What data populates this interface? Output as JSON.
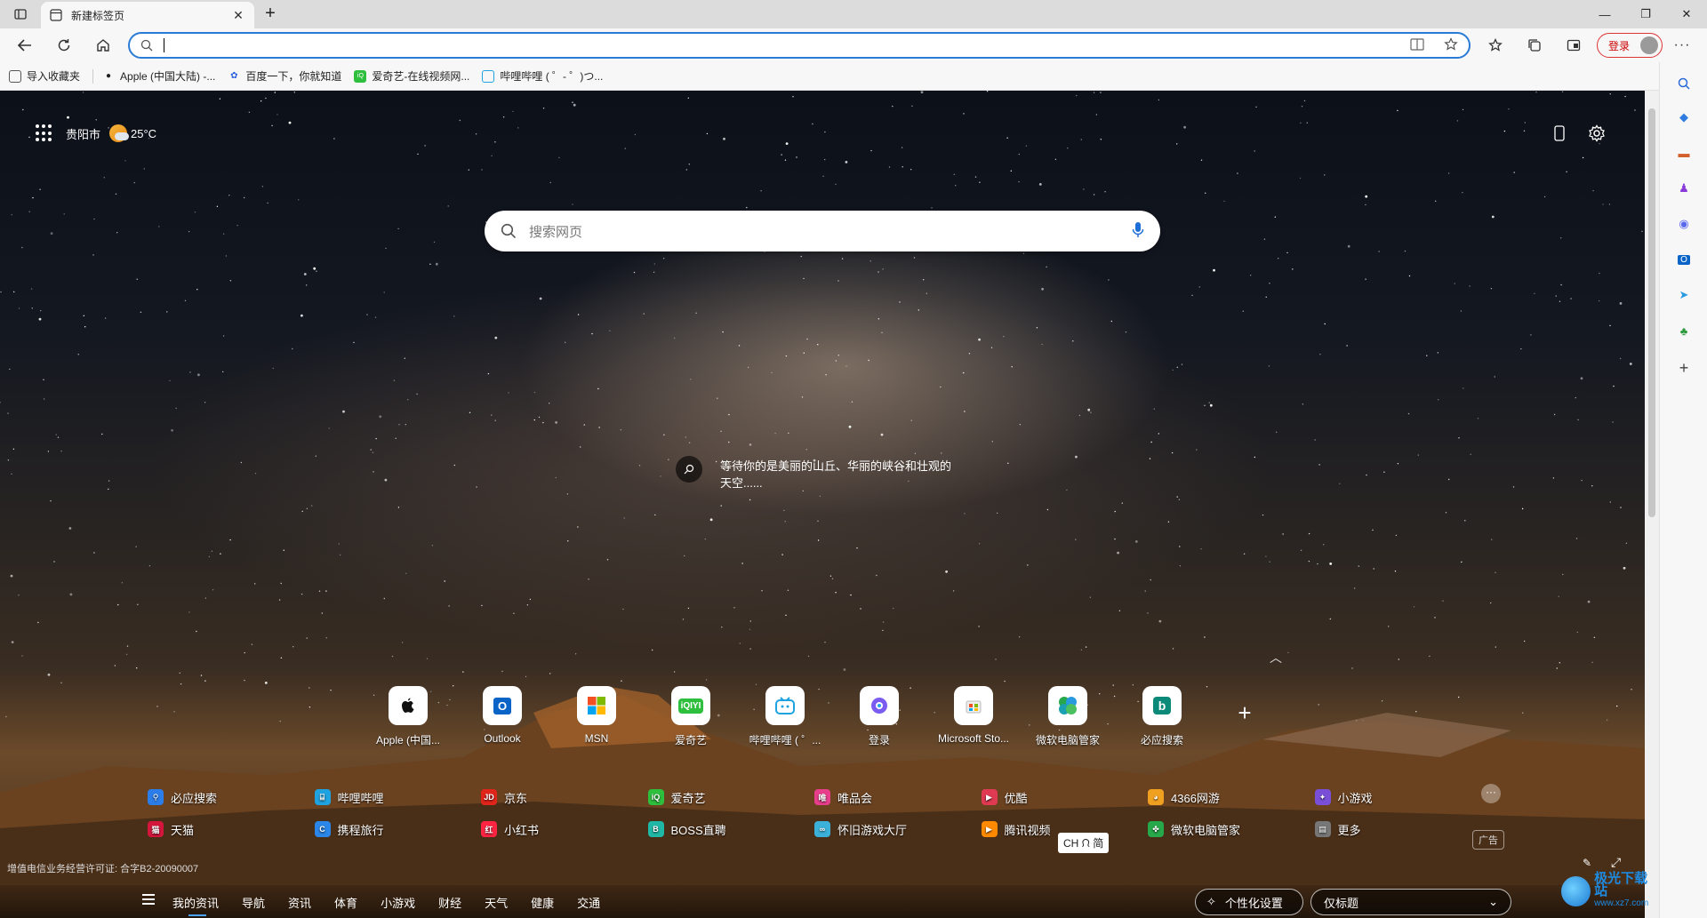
{
  "tab": {
    "title": "新建标签页"
  },
  "address_bar": {
    "value": "",
    "placeholder": ""
  },
  "toolbar": {
    "login_label": "登录"
  },
  "favorites": [
    {
      "label": "导入收藏夹",
      "icon": "import-favorites-icon",
      "color": "#555555"
    },
    {
      "label": "Apple (中国大陆) -...",
      "icon": "apple-icon",
      "color": "#222222"
    },
    {
      "label": "百度一下，你就知道",
      "icon": "baidu-icon",
      "color": "#2a5fe0"
    },
    {
      "label": "爱奇艺-在线视频网...",
      "icon": "iqiyi-icon",
      "color": "#2fbf3e"
    },
    {
      "label": "哔哩哔哩 ( ゜- ゜)つ...",
      "icon": "bilibili-icon",
      "color": "#1fa3e0"
    }
  ],
  "header": {
    "location": "贵阳市",
    "temperature": "25°C"
  },
  "search": {
    "placeholder": "搜索网页"
  },
  "image_caption": "等待你的是美丽的山丘、华丽的峡谷和壮观的天空......",
  "quick_links": [
    {
      "label": "Apple (中国...",
      "icon": "apple-icon",
      "glyph": "",
      "color": "#111111"
    },
    {
      "label": "Outlook",
      "icon": "outlook-icon",
      "glyph": "O",
      "color": "#0a64c8"
    },
    {
      "label": "MSN",
      "icon": "msn-icon",
      "glyph": "▦",
      "color": "#f25022"
    },
    {
      "label": "爱奇艺",
      "icon": "iqiyi-icon",
      "glyph": "iQ",
      "color": "#2fbf3e"
    },
    {
      "label": "哔哩哔哩 ( ゜...",
      "icon": "bilibili-icon",
      "glyph": "⌸",
      "color": "#1fa3e0"
    },
    {
      "label": "登录",
      "icon": "copilot-icon",
      "glyph": "◈",
      "color": "#7b5cf0"
    },
    {
      "label": "Microsoft Sto...",
      "icon": "microsoft-store-icon",
      "glyph": "▣",
      "color": "#d8a010"
    },
    {
      "label": "微软电脑管家",
      "icon": "pc-manager-icon",
      "glyph": "✤",
      "color": "#27a84a"
    },
    {
      "label": "必应搜索",
      "icon": "bing-icon",
      "glyph": "b",
      "color": "#0b8a7a"
    }
  ],
  "link_grid": [
    {
      "label": "必应搜索",
      "icon": "search-icon",
      "glyph": "⚲",
      "color": "#2b7de9"
    },
    {
      "label": "哔哩哔哩",
      "icon": "bilibili-icon",
      "glyph": "⌸",
      "color": "#1fa3e0"
    },
    {
      "label": "京东",
      "icon": "jd-icon",
      "glyph": "JD",
      "color": "#e1251b"
    },
    {
      "label": "爱奇艺",
      "icon": "iqiyi-icon",
      "glyph": "iQ",
      "color": "#2fbf3e"
    },
    {
      "label": "唯品会",
      "icon": "vip-icon",
      "glyph": "唯",
      "color": "#e83e8c"
    },
    {
      "label": "优酷",
      "icon": "youku-icon",
      "glyph": "▶",
      "color": "#e03a52"
    },
    {
      "label": "4366网游",
      "icon": "4366-icon",
      "glyph": "◕",
      "color": "#f0a020"
    },
    {
      "label": "小游戏",
      "icon": "mini-games-icon",
      "glyph": "✦",
      "color": "#7a4fd8"
    },
    {
      "label": "天猫",
      "icon": "tmall-icon",
      "glyph": "猫",
      "color": "#d4163c"
    },
    {
      "label": "携程旅行",
      "icon": "ctrip-icon",
      "glyph": "C",
      "color": "#2a86e8"
    },
    {
      "label": "小红书",
      "icon": "xiaohongshu-icon",
      "glyph": "红",
      "color": "#ff2442"
    },
    {
      "label": "BOSS直聘",
      "icon": "boss-icon",
      "glyph": "B",
      "color": "#1fb8a6"
    },
    {
      "label": "怀旧游戏大厅",
      "icon": "retro-games-icon",
      "glyph": "∞",
      "color": "#3bb0d8"
    },
    {
      "label": "腾讯视频",
      "icon": "tencent-video-icon",
      "glyph": "▶",
      "color": "#ff8a00"
    },
    {
      "label": "微软电脑管家",
      "icon": "pc-manager-icon",
      "glyph": "✤",
      "color": "#27a84a"
    },
    {
      "label": "更多",
      "icon": "more-icon",
      "glyph": "▤",
      "color": "#777777"
    }
  ],
  "ad_badge": "广告",
  "ime": "CH ᙁ 简",
  "license": "增值电信业务经营许可证: 合字B2-20090007",
  "bottom_tabs": [
    "我的资讯",
    "导航",
    "资讯",
    "体育",
    "小游戏",
    "财经",
    "天气",
    "健康",
    "交通"
  ],
  "personalize_label": "个性化设置",
  "layout_select": {
    "value": "仅标题"
  },
  "watermark": {
    "main": "极光下载站",
    "sub": "www.xz7.com"
  }
}
